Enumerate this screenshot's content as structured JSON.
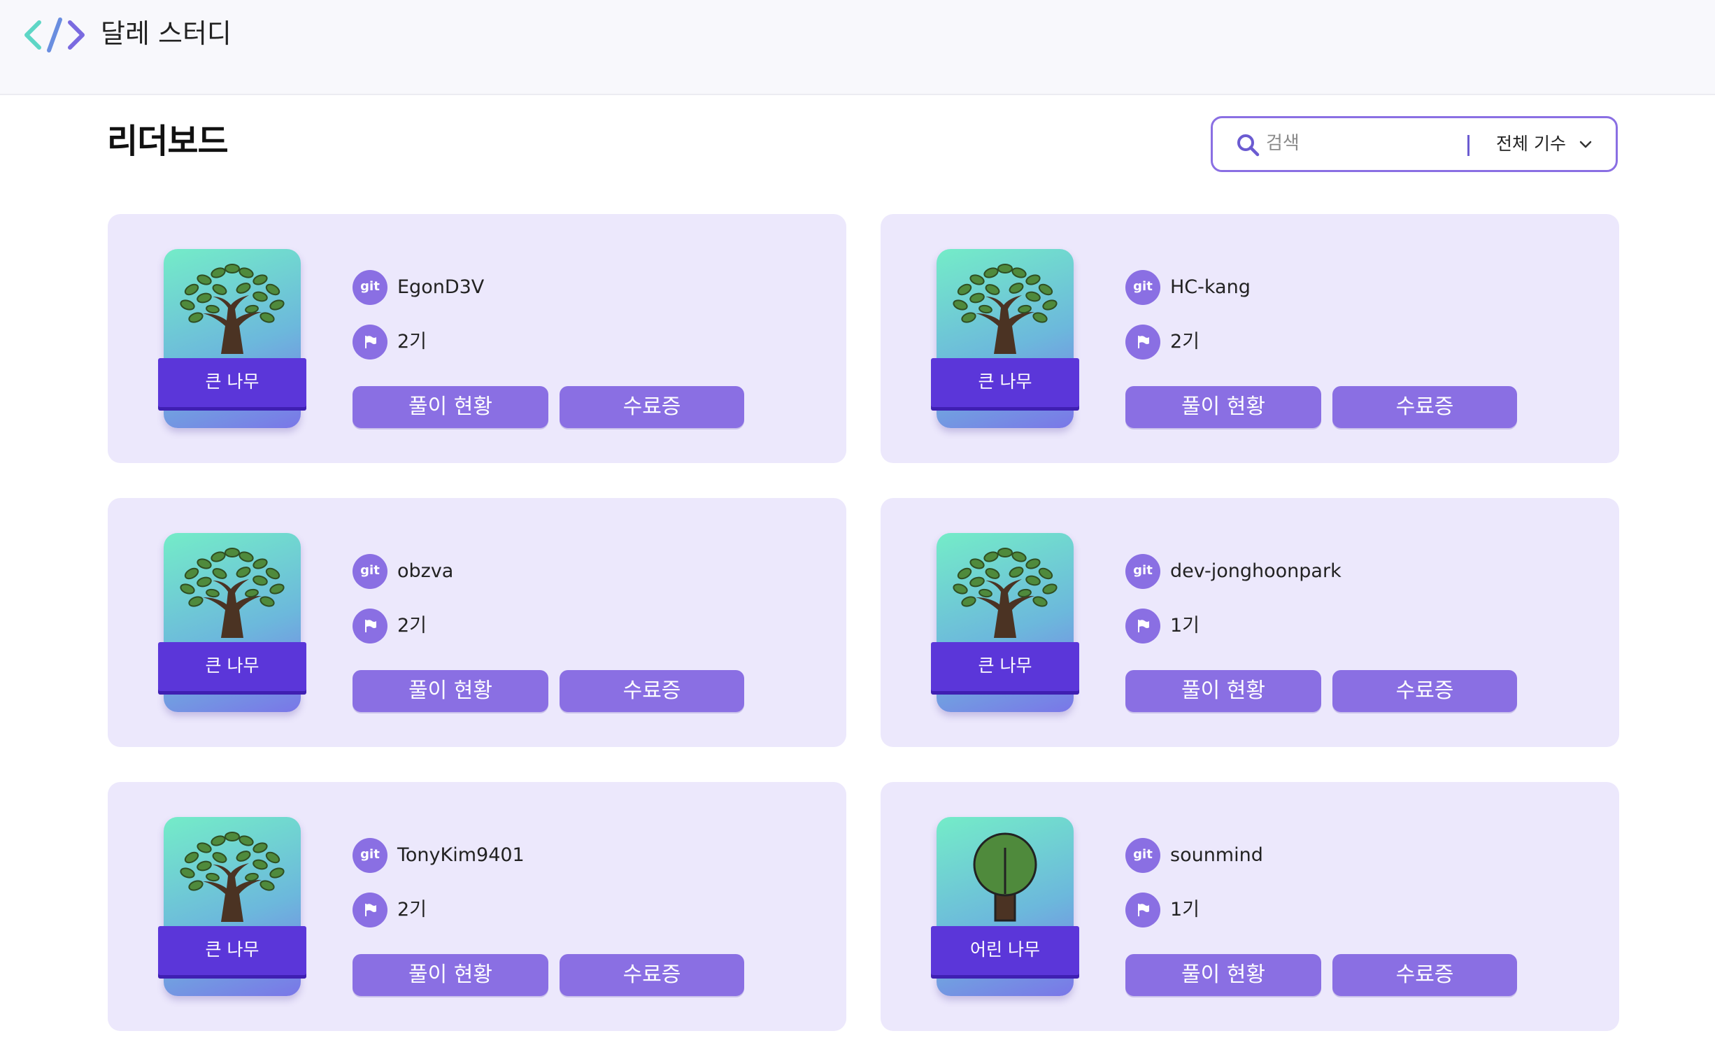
{
  "header": {
    "brand": "달레 스터디",
    "logo_icon": "code-brackets-icon"
  },
  "page_title": "리더보드",
  "search": {
    "placeholder": "검색",
    "value": "",
    "cohort_select": "전체 기수"
  },
  "card_actions": {
    "progress_label": "풀이 현황",
    "certificate_label": "수료증"
  },
  "colors": {
    "accent": "#8a6fe3",
    "card_bg": "#ece8fc",
    "ribbon": "#5b36d9"
  },
  "members": [
    {
      "username": "EgonD3V",
      "cohort": "2기",
      "grade": "큰 나무",
      "grade_icon": "big-tree-icon"
    },
    {
      "username": "HC-kang",
      "cohort": "2기",
      "grade": "큰 나무",
      "grade_icon": "big-tree-icon"
    },
    {
      "username": "obzva",
      "cohort": "2기",
      "grade": "큰 나무",
      "grade_icon": "big-tree-icon"
    },
    {
      "username": "dev-jonghoonpark",
      "cohort": "1기",
      "grade": "큰 나무",
      "grade_icon": "big-tree-icon"
    },
    {
      "username": "TonyKim9401",
      "cohort": "2기",
      "grade": "큰 나무",
      "grade_icon": "big-tree-icon"
    },
    {
      "username": "sounmind",
      "cohort": "1기",
      "grade": "어린 나무",
      "grade_icon": "young-tree-icon"
    }
  ],
  "icons": {
    "git_text": "git",
    "flag": "flag-icon",
    "search": "search-icon",
    "chevron": "chevron-down-icon"
  }
}
